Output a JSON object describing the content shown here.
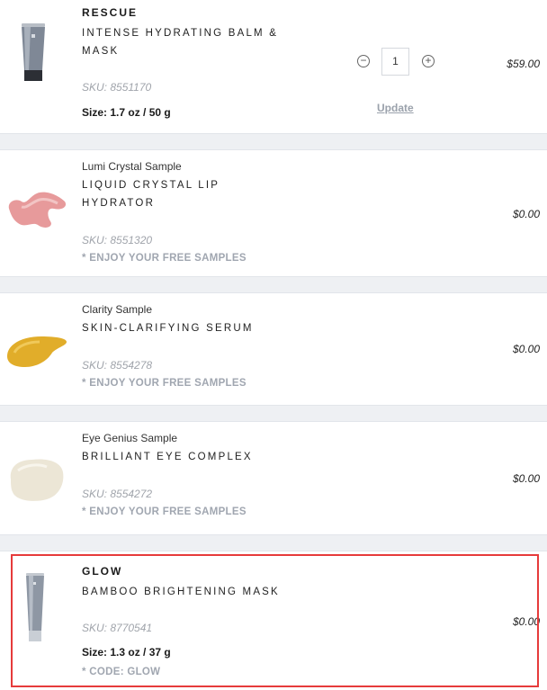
{
  "items": [
    {
      "brand": "RESCUE",
      "name_lines": [
        "INTENSE HYDRATING BALM &",
        "MASK"
      ],
      "sku": "SKU: 8551170",
      "size": "Size: 1.7 oz / 50 g",
      "price": "$59.00",
      "quantity": "1",
      "update_label": "Update",
      "thumb_icon": "tube-icon"
    },
    {
      "subtitle": "Lumi Crystal Sample",
      "name_lines": [
        "LIQUID CRYSTAL LIP",
        "HYDRATOR"
      ],
      "sku": "SKU: 8551320",
      "note": "* ENJOY YOUR FREE SAMPLES",
      "price": "$0.00",
      "thumb_icon": "pink-swatch-icon"
    },
    {
      "subtitle": "Clarity Sample",
      "name_lines": [
        "SKIN-CLARIFYING SERUM"
      ],
      "sku": "SKU: 8554278",
      "note": "* ENJOY YOUR FREE SAMPLES",
      "price": "$0.00",
      "thumb_icon": "yellow-swatch-icon"
    },
    {
      "subtitle": "Eye Genius Sample",
      "name_lines": [
        "BRILLIANT EYE COMPLEX"
      ],
      "sku": "SKU: 8554272",
      "note": "* ENJOY YOUR FREE SAMPLES",
      "price": "$0.00",
      "thumb_icon": "cream-swatch-icon"
    },
    {
      "brand": "GLOW",
      "name_lines": [
        "BAMBOO BRIGHTENING MASK"
      ],
      "sku": "SKU: 8770541",
      "size": "Size: 1.3 oz / 37 g",
      "note": "* CODE: GLOW",
      "price": "$0.00",
      "thumb_icon": "tube-icon"
    }
  ],
  "colors": {
    "highlight": "#e63b3b",
    "separator": "#eef0f3",
    "muted": "#a0a6b0"
  }
}
